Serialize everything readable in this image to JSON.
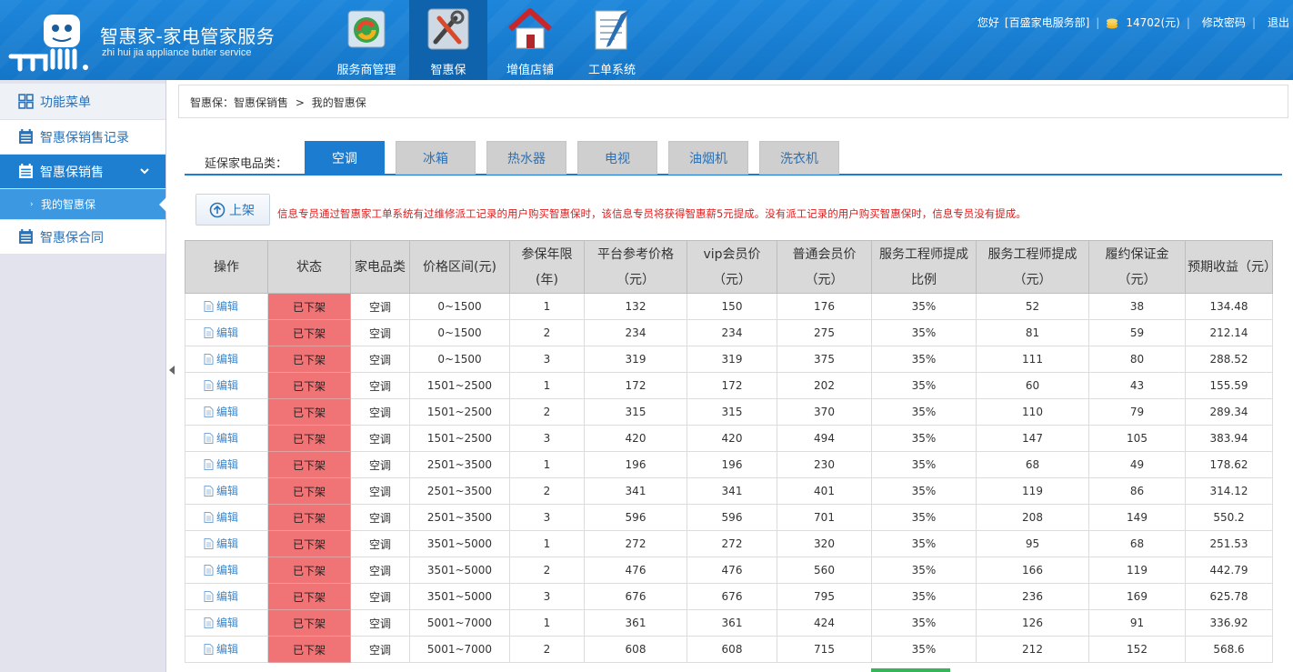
{
  "header": {
    "brand_title": "智惠家-家电管家服务",
    "brand_subtitle": "zhi hui jia appliance butler service",
    "nav": [
      {
        "label": "服务商管理",
        "icon": "service-provider-icon",
        "active": false
      },
      {
        "label": "智惠保",
        "icon": "tools-icon",
        "active": true
      },
      {
        "label": "增值店铺",
        "icon": "house-icon",
        "active": false
      },
      {
        "label": "工单系统",
        "icon": "notepad-icon",
        "active": false
      }
    ],
    "greeting": "您好",
    "org": "[百盛家电服务部]",
    "balance": "14702(元)",
    "change_password": "修改密码",
    "logout": "退出"
  },
  "sidebar": {
    "menu_title": "功能菜单",
    "items": [
      {
        "label": "智惠保销售记录"
      },
      {
        "label": "智惠保销售"
      },
      {
        "label": "我的智惠保"
      },
      {
        "label": "智惠保合同"
      }
    ]
  },
  "breadcrumb": {
    "root": "智惠保：",
    "parent": "智惠保销售",
    "sep": ">",
    "current": "我的智惠保"
  },
  "tabs": {
    "label": "延保家电品类：",
    "items": [
      "空调",
      "冰箱",
      "热水器",
      "电视",
      "油烟机",
      "洗衣机"
    ],
    "active": "空调"
  },
  "actions": {
    "up_label": "上架",
    "notice": "信息专员通过智惠家工单系统有过维修派工记录的用户购买智惠保时，该信息专员将获得智惠薪5元提成。没有派工记录的用户购买智惠保时，信息专员没有提成。"
  },
  "table": {
    "headers": [
      "操作",
      "状态",
      "家电品类",
      "价格区间(元)",
      "参保年限(年)",
      "平台参考价格（元）",
      "vip会员价（元）",
      "普通会员价（元）",
      "服务工程师提成比例",
      "服务工程师提成（元）",
      "履约保证金（元）",
      "预期收益（元）"
    ],
    "edit_label": "编辑",
    "rows": [
      {
        "status": "已下架",
        "category": "空调",
        "range": "0~1500",
        "years": "1",
        "platform": "132",
        "vip": "150",
        "normal": "176",
        "ratio": "35%",
        "commission": "52",
        "deposit": "38",
        "income": "134.48"
      },
      {
        "status": "已下架",
        "category": "空调",
        "range": "0~1500",
        "years": "2",
        "platform": "234",
        "vip": "234",
        "normal": "275",
        "ratio": "35%",
        "commission": "81",
        "deposit": "59",
        "income": "212.14"
      },
      {
        "status": "已下架",
        "category": "空调",
        "range": "0~1500",
        "years": "3",
        "platform": "319",
        "vip": "319",
        "normal": "375",
        "ratio": "35%",
        "commission": "111",
        "deposit": "80",
        "income": "288.52"
      },
      {
        "status": "已下架",
        "category": "空调",
        "range": "1501~2500",
        "years": "1",
        "platform": "172",
        "vip": "172",
        "normal": "202",
        "ratio": "35%",
        "commission": "60",
        "deposit": "43",
        "income": "155.59"
      },
      {
        "status": "已下架",
        "category": "空调",
        "range": "1501~2500",
        "years": "2",
        "platform": "315",
        "vip": "315",
        "normal": "370",
        "ratio": "35%",
        "commission": "110",
        "deposit": "79",
        "income": "289.34"
      },
      {
        "status": "已下架",
        "category": "空调",
        "range": "1501~2500",
        "years": "3",
        "platform": "420",
        "vip": "420",
        "normal": "494",
        "ratio": "35%",
        "commission": "147",
        "deposit": "105",
        "income": "383.94"
      },
      {
        "status": "已下架",
        "category": "空调",
        "range": "2501~3500",
        "years": "1",
        "platform": "196",
        "vip": "196",
        "normal": "230",
        "ratio": "35%",
        "commission": "68",
        "deposit": "49",
        "income": "178.62"
      },
      {
        "status": "已下架",
        "category": "空调",
        "range": "2501~3500",
        "years": "2",
        "platform": "341",
        "vip": "341",
        "normal": "401",
        "ratio": "35%",
        "commission": "119",
        "deposit": "86",
        "income": "314.12"
      },
      {
        "status": "已下架",
        "category": "空调",
        "range": "2501~3500",
        "years": "3",
        "platform": "596",
        "vip": "596",
        "normal": "701",
        "ratio": "35%",
        "commission": "208",
        "deposit": "149",
        "income": "550.2"
      },
      {
        "status": "已下架",
        "category": "空调",
        "range": "3501~5000",
        "years": "1",
        "platform": "272",
        "vip": "272",
        "normal": "320",
        "ratio": "35%",
        "commission": "95",
        "deposit": "68",
        "income": "251.53"
      },
      {
        "status": "已下架",
        "category": "空调",
        "range": "3501~5000",
        "years": "2",
        "platform": "476",
        "vip": "476",
        "normal": "560",
        "ratio": "35%",
        "commission": "166",
        "deposit": "119",
        "income": "442.79"
      },
      {
        "status": "已下架",
        "category": "空调",
        "range": "3501~5000",
        "years": "3",
        "platform": "676",
        "vip": "676",
        "normal": "795",
        "ratio": "35%",
        "commission": "236",
        "deposit": "169",
        "income": "625.78"
      },
      {
        "status": "已下架",
        "category": "空调",
        "range": "5001~7000",
        "years": "1",
        "platform": "361",
        "vip": "361",
        "normal": "424",
        "ratio": "35%",
        "commission": "126",
        "deposit": "91",
        "income": "336.92"
      },
      {
        "status": "已下架",
        "category": "空调",
        "range": "5001~7000",
        "years": "2",
        "platform": "608",
        "vip": "608",
        "normal": "715",
        "ratio": "35%",
        "commission": "212",
        "deposit": "152",
        "income": "568.6"
      }
    ]
  },
  "colors": {
    "header_blue": "#1d86db",
    "active_tab": "#1b7cd0",
    "status_red": "#f07375",
    "notice_red": "#e01a1a",
    "link_blue": "#3b86cc"
  }
}
